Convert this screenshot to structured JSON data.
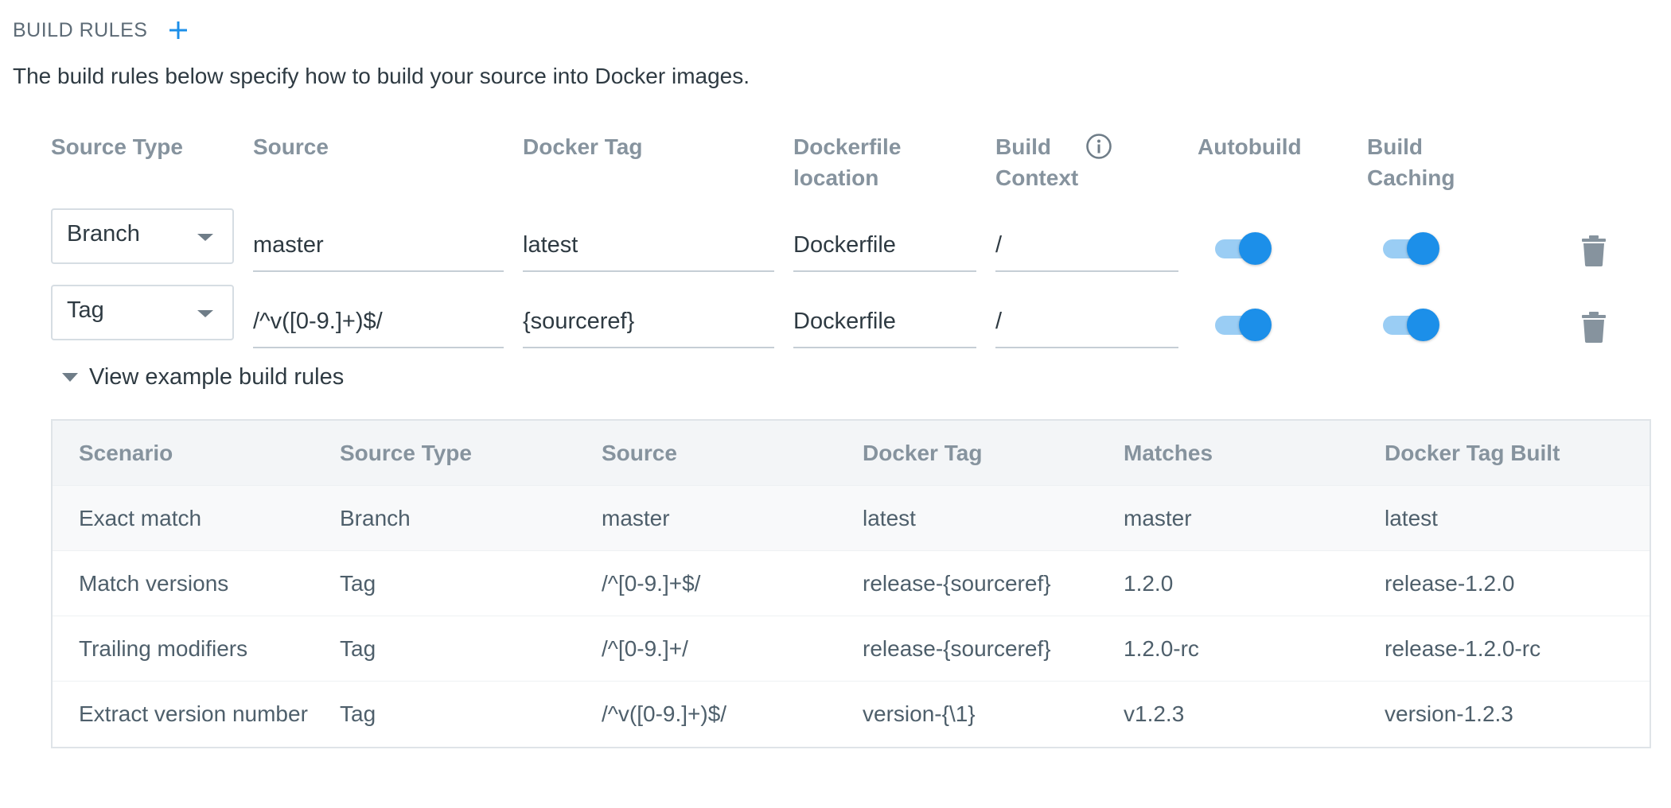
{
  "header": {
    "title": "BUILD RULES",
    "add_icon": "plus-icon",
    "description": "The build rules below specify how to build your source into Docker images."
  },
  "columns": {
    "source_type": "Source Type",
    "source": "Source",
    "docker_tag": "Docker Tag",
    "dockerfile_location_1": "Dockerfile",
    "dockerfile_location_2": "location",
    "build_context_1": "Build",
    "build_context_2": "Context",
    "autobuild": "Autobuild",
    "build_caching_1": "Build",
    "build_caching_2": "Caching"
  },
  "rules": [
    {
      "source_type": "Branch",
      "source": "master",
      "docker_tag": "latest",
      "dockerfile_location": "Dockerfile",
      "build_context": "/",
      "autobuild": true,
      "build_caching": true
    },
    {
      "source_type": "Tag",
      "source": "/^v([0-9.]+)$/",
      "docker_tag": "{sourceref}",
      "dockerfile_location": "Dockerfile",
      "build_context": "/",
      "autobuild": true,
      "build_caching": true
    }
  ],
  "examples": {
    "toggle_label": "View example build rules",
    "headers": [
      "Scenario",
      "Source Type",
      "Source",
      "Docker Tag",
      "Matches",
      "Docker Tag Built"
    ],
    "rows": [
      [
        "Exact match",
        "Branch",
        "master",
        "latest",
        "master",
        "latest"
      ],
      [
        "Match versions",
        "Tag",
        "/^[0-9.]+$/",
        "release-{sourceref}",
        "1.2.0",
        "release-1.2.0"
      ],
      [
        "Trailing modifiers",
        "Tag",
        "/^[0-9.]+/",
        "release-{sourceref}",
        "1.2.0-rc",
        "release-1.2.0-rc"
      ],
      [
        "Extract version number",
        "Tag",
        "/^v([0-9.]+)$/",
        "version-{\\1}",
        "v1.2.3",
        "version-1.2.3"
      ]
    ]
  },
  "colors": {
    "accent": "#1c8fe9",
    "toggle_track": "#9acdf4",
    "heading": "#86939e",
    "text": "#2e3a42"
  }
}
